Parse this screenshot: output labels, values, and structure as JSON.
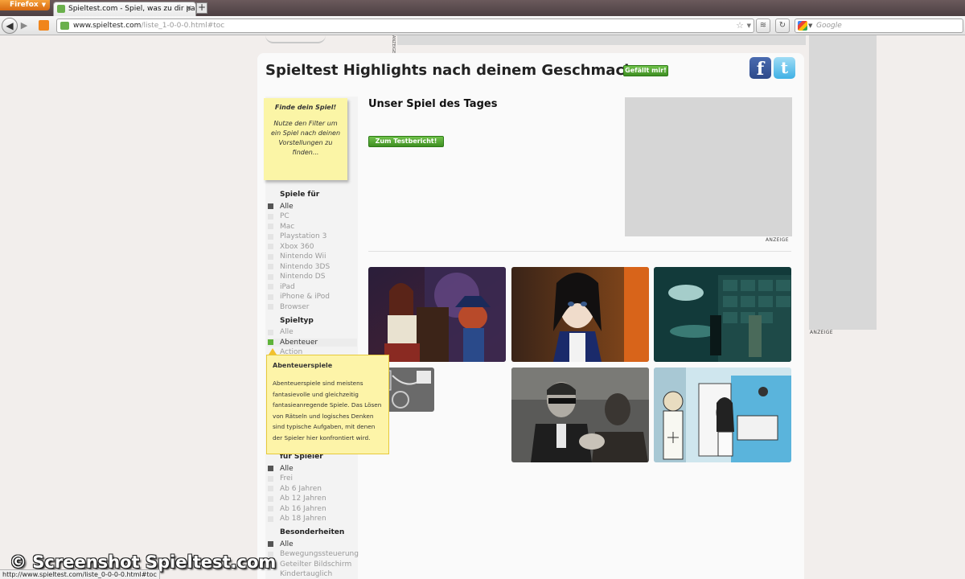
{
  "browser": {
    "menu_label": "Firefox",
    "tab_title": "Spieltest.com - Spiel, was zu dir passt!",
    "url_domain": "www.spieltest.com",
    "url_path": "/liste_1-0-0-0.html#toc",
    "search_placeholder": "Google",
    "status_url": "http://www.spieltest.com/liste_0-0-0-0.html#toc"
  },
  "header": {
    "headline": "Spieltest Highlights nach deinem Geschmack...",
    "like_label": "Gefällt mir!",
    "facebook_glyph": "f",
    "twitter_glyph": "t"
  },
  "sticky_note": {
    "title": "Finde dein Spiel!",
    "text": "Nutze den Filter um ein Spiel nach deinen Vorstellungen zu finden..."
  },
  "filters": {
    "platform": {
      "title": "Spiele für",
      "items": [
        "Alle",
        "PC",
        "Mac",
        "Playstation 3",
        "Xbox 360",
        "Nintendo Wii",
        "Nintendo 3DS",
        "Nintendo DS",
        "iPad",
        "iPhone & iPod",
        "Browser"
      ]
    },
    "genre": {
      "title": "Spieltyp",
      "items": [
        "Alle",
        "Abenteuer",
        "Action"
      ]
    },
    "age": {
      "title": "für Spieler",
      "items": [
        "Alle",
        "Frei",
        "Ab 6 Jahren",
        "Ab 12 Jahren",
        "Ab 16 Jahren",
        "Ab 18 Jahren"
      ]
    },
    "features": {
      "title": "Besonderheiten",
      "items": [
        "Alle",
        "Bewegungssteuerung",
        "Geteilter Bildschirm",
        "Kindertauglich"
      ]
    }
  },
  "tooltip": {
    "title": "Abenteuerspiele",
    "text": "Abenteuerspiele sind meistens fantasievolle und gleichzeitig fantasieanregende Spiele. Das Lösen von Rätseln und logisches Denken sind typische Aufgaben, mit denen der Spieler hier konfrontiert wird."
  },
  "main": {
    "title": "Unser Spiel des Tages",
    "test_button": "Zum Testbericht!",
    "ad_label": "ANZEIGE"
  },
  "right_ad_label": "ANZEIGE",
  "top_banner_label": "ANZEIGE",
  "watermark": "© Screenshot Spieltest.com",
  "colors": {
    "accent_green": "#5fb33a",
    "tooltip_yellow": "#fdf4a8",
    "sticky_yellow": "#fbf5a6",
    "facebook": "#3b5998",
    "twitter": "#55c0ee"
  }
}
